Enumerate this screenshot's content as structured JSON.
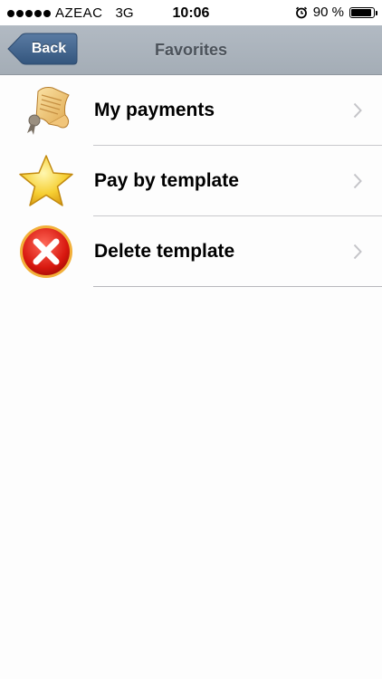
{
  "status_bar": {
    "carrier": "AZEAC",
    "network": "3G",
    "time": "10:06",
    "battery_percent": "90 %",
    "battery_level": 0.9
  },
  "nav": {
    "back_label": "Back",
    "title": "Favorites"
  },
  "menu": {
    "items": [
      {
        "label": "My payments",
        "icon": "receipt-scroll-icon"
      },
      {
        "label": "Pay by template",
        "icon": "star-icon"
      },
      {
        "label": "Delete template",
        "icon": "delete-x-icon"
      }
    ]
  },
  "colors": {
    "nav_bar": "#a9b2bb",
    "back_button": "#3d5f87",
    "title_text": "#4b525a",
    "divider": "#c8c8cc"
  }
}
